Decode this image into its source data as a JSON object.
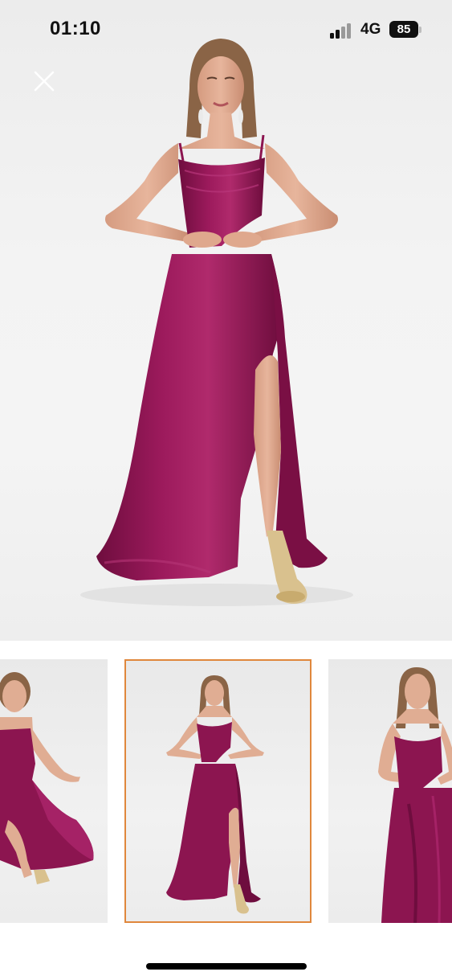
{
  "status_bar": {
    "time": "01:10",
    "network": "4G",
    "battery": "85"
  },
  "colors": {
    "dress": "#8c1550",
    "selected_border": "#e0873c",
    "background": "#ffffff"
  },
  "gallery": {
    "selected_index": 1,
    "thumbnails": [
      {
        "icon": "dress-photo-side-view"
      },
      {
        "icon": "dress-photo-front-view"
      },
      {
        "icon": "dress-photo-close-view"
      }
    ]
  },
  "icons": {
    "close": "close-icon",
    "signal": "cellular-signal-icon"
  }
}
